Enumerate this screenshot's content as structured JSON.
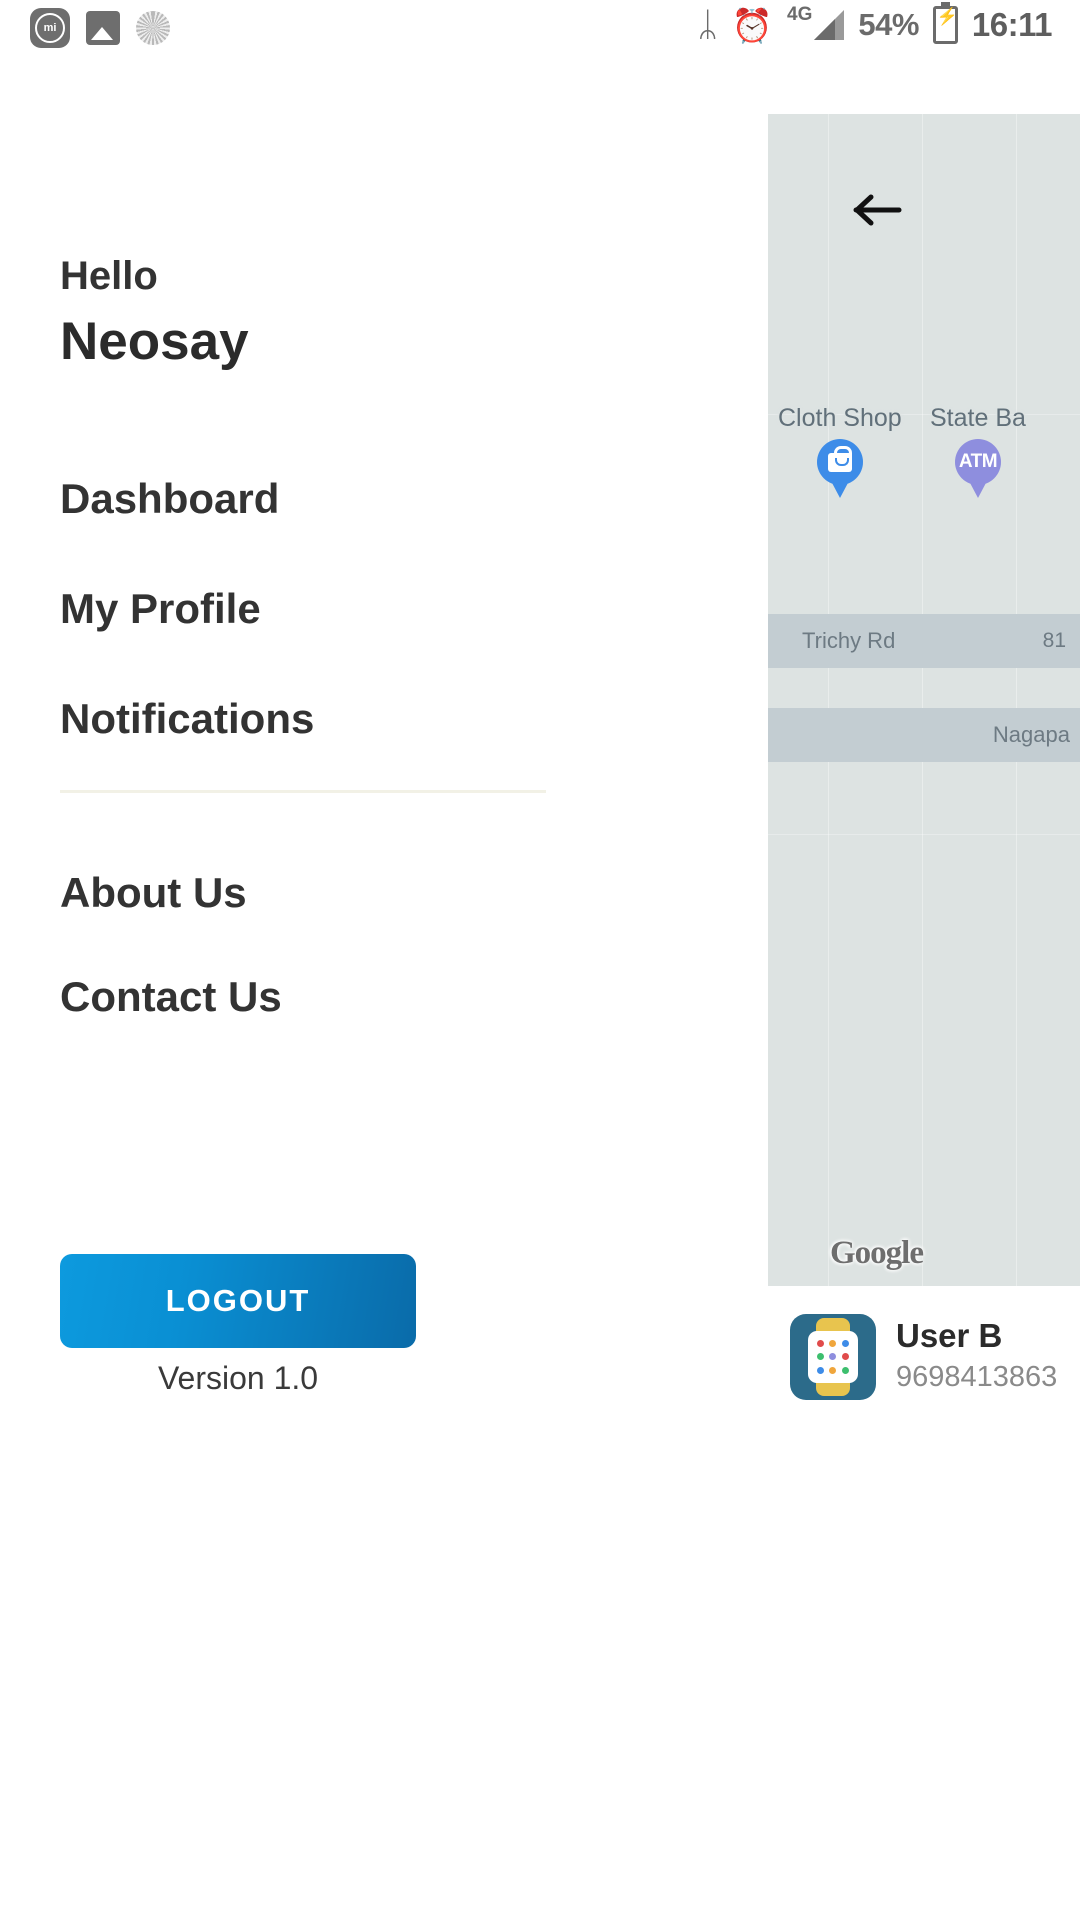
{
  "status_bar": {
    "left_icons": [
      {
        "name": "mi-app-icon",
        "glyph": "mi"
      },
      {
        "name": "gallery-icon",
        "glyph": ""
      },
      {
        "name": "sync-spinner-icon",
        "glyph": ""
      }
    ],
    "bluetooth_glyph": "ᛦ",
    "alarm_glyph": "⏰",
    "network_type": "4G",
    "battery_percent": "54%",
    "time": "16:11"
  },
  "drawer": {
    "greeting": "Hello",
    "user_name": "Neosay",
    "items": [
      {
        "label": "Dashboard"
      },
      {
        "label": "My Profile"
      },
      {
        "label": "Notifications"
      },
      {
        "label": "About Us"
      },
      {
        "label": "Contact Us"
      }
    ],
    "logout_label": "LOGOUT",
    "version_label": "Version 1.0"
  },
  "map": {
    "back_icon": "arrow-left-icon",
    "pois": [
      {
        "label": "Cloth Shop",
        "pin": "shopping-bag-pin",
        "color": "#3d8ce8"
      },
      {
        "label": "State Ba",
        "pin": "atm-pin",
        "color": "#8e8ede",
        "badge": "ATM"
      }
    ],
    "roads": [
      {
        "name": "Trichy Rd",
        "number": "81"
      },
      {
        "name": "Nagapa",
        "number": ""
      }
    ],
    "watermark": "Google",
    "background_color": "#dde3e2",
    "road_color": "#c3cdd2"
  },
  "user_card": {
    "name": "User B",
    "phone": "9698413863",
    "avatar_icon": "smartwatch-icon"
  },
  "colors": {
    "accent_light": "#0d9ade",
    "accent_dark": "#0a6ba9",
    "text_primary": "#2b2b2b",
    "divider": "#f2f1e6"
  }
}
